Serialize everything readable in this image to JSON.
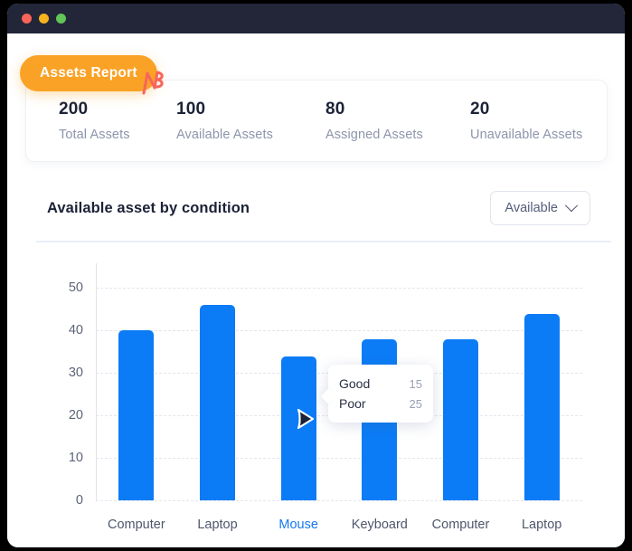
{
  "window": {
    "dots": [
      "close-dot",
      "minimize-dot",
      "maximize-dot"
    ]
  },
  "badge": {
    "label": "Assets Report"
  },
  "stats": [
    {
      "value": "200",
      "label": "Total Assets"
    },
    {
      "value": "100",
      "label": "Available Assets"
    },
    {
      "value": "80",
      "label": "Assigned Assets"
    },
    {
      "value": "20",
      "label": "Unavailable Assets"
    }
  ],
  "chart_header": {
    "title": "Available asset by condition",
    "filter_value": "Available"
  },
  "tooltip": {
    "rows": [
      {
        "key": "Good",
        "value": "15"
      },
      {
        "key": "Poor",
        "value": "25"
      }
    ]
  },
  "chart_data": {
    "type": "bar",
    "title": "Available asset by condition",
    "xlabel": "",
    "ylabel": "",
    "categories": [
      "Computer",
      "Laptop",
      "Mouse",
      "Keyboard",
      "Computer",
      "Laptop"
    ],
    "values": [
      40,
      46,
      34,
      38,
      38,
      44
    ],
    "highlighted_category": "Mouse",
    "ylim": [
      0,
      55
    ],
    "yticks": [
      0,
      10,
      20,
      30,
      40,
      50
    ],
    "ytick_labels": [
      "0",
      "10",
      "20",
      "30",
      "40",
      "50"
    ],
    "grid": true,
    "legend": "none",
    "bar_color": "#0b7cf5",
    "hovered_index": 2,
    "hover_breakdown": {
      "Good": 15,
      "Poor": 25
    }
  },
  "colors": {
    "accent_blue": "#0b7cf5",
    "badge_orange": "#f9a226",
    "titlebar": "#222638",
    "click_mark": "#f9645c"
  }
}
